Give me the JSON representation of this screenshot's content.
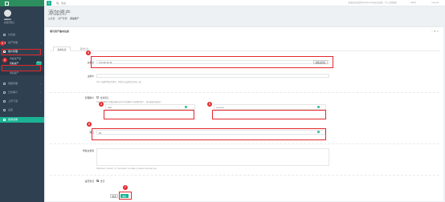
{
  "sidebar": {
    "user_name": "admin",
    "user_role": "超级管理员",
    "items": [
      {
        "label": "仪表盘"
      },
      {
        "label": "资产管理"
      },
      {
        "label": "用户管理"
      },
      {
        "label": "调度管理"
      },
      {
        "label": "日志审计"
      },
      {
        "label": "上传下载"
      },
      {
        "label": "设置"
      },
      {
        "label": "使用说明"
      }
    ],
    "subitems": [
      {
        "label": "查看资产组"
      },
      {
        "label": "查看资产"
      },
      {
        "label": "添加资产"
      }
    ],
    "badge": "NEW"
  },
  "topbar": {
    "crumb": "嗨，欢迎",
    "message": "您还未完成您的Jumpserver的安全设置，马上立即更正",
    "user": "admin",
    "logout": "Log out"
  },
  "page": {
    "title": "添加资产",
    "breadcrumbs": [
      "仪表盘",
      "资产管理",
      "添加资产"
    ]
  },
  "panel": {
    "title": "填写资产基本信息",
    "tabs": [
      "基本信息",
      "其他信息"
    ]
  },
  "form": {
    "hostname_label": "主机名",
    "hostname_value": "172.20.14.13",
    "hostname_button": "获取主机名",
    "ip_label": "主机IP",
    "ip_help": "Tips: 如果IP地址不填写，IP默认会设置成主机名一致",
    "admin_label": "管理用户",
    "use_default_label": "使用默认",
    "default_help": "Tips: 管理用户是服务器存在的root或拥有root权限的用户，用来推送系统用户",
    "user_value": "root",
    "password_value": "••••••••••",
    "port_label": "端口",
    "port_value": "22",
    "group_label": "所属主机组",
    "group_help": "Hold down \"Control\", or \"Command\" on a Mac, to select more than one.",
    "active_label": "是否激活",
    "active_option": "激活",
    "cancel_button": "取消",
    "submit_button": "确认"
  },
  "annotations": [
    "1",
    "2",
    "3",
    "4",
    "5",
    "6",
    "7"
  ],
  "colors": {
    "sidebar": "#2f4050",
    "accent": "#1ab394",
    "annotation": "#e3282e"
  }
}
